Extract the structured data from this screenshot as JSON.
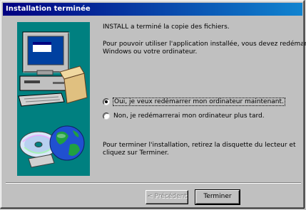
{
  "window": {
    "title": "Installation terminée"
  },
  "content": {
    "heading": "INSTALL a terminé la copie des fichiers.",
    "restart_info_line1": "Pour pouvoir utiliser l'application installée, vous devez redémarrer",
    "restart_info_line2": "Windows ou votre ordinateur.",
    "options": [
      {
        "label": "Oui, je veux redémarrer mon ordinateur maintenant.",
        "selected": true
      },
      {
        "label": "Non, je redémarrerai mon ordinateur plus tard.",
        "selected": false
      }
    ],
    "finish_note_line1": "Pour terminer l'installation, retirez la disquette du lecteur et",
    "finish_note_line2": "cliquez sur Terminer."
  },
  "buttons": {
    "back_label": "< Précédent",
    "finish_label": "Terminer"
  },
  "colors": {
    "title_start": "#000080",
    "title_end": "#1084d0",
    "art_background": "#008080",
    "face": "#c0c0c0"
  }
}
